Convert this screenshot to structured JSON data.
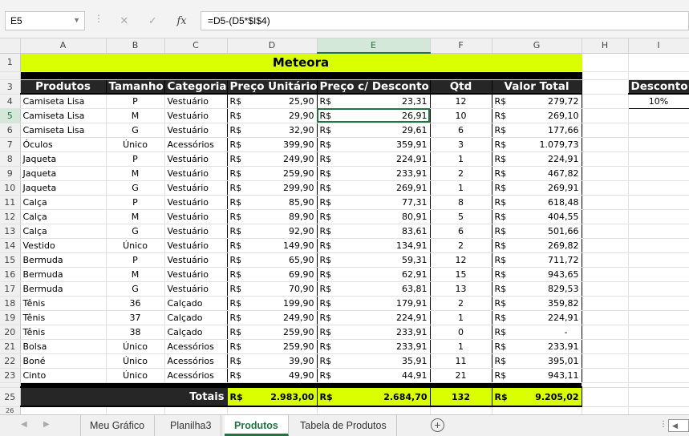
{
  "formula_bar": {
    "name_box": "E5",
    "formula": "=D5-(D5*$I$4)",
    "cancel_icon": "✕",
    "enter_icon": "✓",
    "fx_label": "fx"
  },
  "columns": [
    "A",
    "B",
    "C",
    "D",
    "E",
    "F",
    "G",
    "H",
    "I"
  ],
  "row_numbers": {
    "r1": "1",
    "r3": "3",
    "r25": "25",
    "r26": "26"
  },
  "title": "Meteora",
  "headers": {
    "produtos": "Produtos",
    "tamanho": "Tamanho",
    "categoria": "Categoria",
    "preco_unit": "Preço Unitário",
    "preco_desc": "Preço c/ Desconto",
    "qtd": "Qtd",
    "valor_total": "Valor Total"
  },
  "currency": "R$",
  "rows": [
    {
      "n": "4",
      "produto": "Camiseta Lisa",
      "tamanho": "P",
      "categoria": "Vestuário",
      "preco": "25,90",
      "desc": "23,31",
      "qtd": "12",
      "total": "279,72"
    },
    {
      "n": "5",
      "produto": "Camiseta Lisa",
      "tamanho": "M",
      "categoria": "Vestuário",
      "preco": "29,90",
      "desc": "26,91",
      "qtd": "10",
      "total": "269,10"
    },
    {
      "n": "6",
      "produto": "Camiseta Lisa",
      "tamanho": "G",
      "categoria": "Vestuário",
      "preco": "32,90",
      "desc": "29,61",
      "qtd": "6",
      "total": "177,66"
    },
    {
      "n": "7",
      "produto": "Óculos",
      "tamanho": "Único",
      "categoria": "Acessórios",
      "preco": "399,90",
      "desc": "359,91",
      "qtd": "3",
      "total": "1.079,73"
    },
    {
      "n": "8",
      "produto": "Jaqueta",
      "tamanho": "P",
      "categoria": "Vestuário",
      "preco": "249,90",
      "desc": "224,91",
      "qtd": "1",
      "total": "224,91"
    },
    {
      "n": "9",
      "produto": "Jaqueta",
      "tamanho": "M",
      "categoria": "Vestuário",
      "preco": "259,90",
      "desc": "233,91",
      "qtd": "2",
      "total": "467,82"
    },
    {
      "n": "10",
      "produto": "Jaqueta",
      "tamanho": "G",
      "categoria": "Vestuário",
      "preco": "299,90",
      "desc": "269,91",
      "qtd": "1",
      "total": "269,91"
    },
    {
      "n": "11",
      "produto": "Calça",
      "tamanho": "P",
      "categoria": "Vestuário",
      "preco": "85,90",
      "desc": "77,31",
      "qtd": "8",
      "total": "618,48"
    },
    {
      "n": "12",
      "produto": "Calça",
      "tamanho": "M",
      "categoria": "Vestuário",
      "preco": "89,90",
      "desc": "80,91",
      "qtd": "5",
      "total": "404,55"
    },
    {
      "n": "13",
      "produto": "Calça",
      "tamanho": "G",
      "categoria": "Vestuário",
      "preco": "92,90",
      "desc": "83,61",
      "qtd": "6",
      "total": "501,66"
    },
    {
      "n": "14",
      "produto": "Vestido",
      "tamanho": "Único",
      "categoria": "Vestuário",
      "preco": "149,90",
      "desc": "134,91",
      "qtd": "2",
      "total": "269,82"
    },
    {
      "n": "15",
      "produto": "Bermuda",
      "tamanho": "P",
      "categoria": "Vestuário",
      "preco": "65,90",
      "desc": "59,31",
      "qtd": "12",
      "total": "711,72"
    },
    {
      "n": "16",
      "produto": "Bermuda",
      "tamanho": "M",
      "categoria": "Vestuário",
      "preco": "69,90",
      "desc": "62,91",
      "qtd": "15",
      "total": "943,65"
    },
    {
      "n": "17",
      "produto": "Bermuda",
      "tamanho": "G",
      "categoria": "Vestuário",
      "preco": "70,90",
      "desc": "63,81",
      "qtd": "13",
      "total": "829,53"
    },
    {
      "n": "18",
      "produto": "Tênis",
      "tamanho": "36",
      "categoria": "Calçado",
      "preco": "199,90",
      "desc": "179,91",
      "qtd": "2",
      "total": "359,82"
    },
    {
      "n": "19",
      "produto": "Tênis",
      "tamanho": "37",
      "categoria": "Calçado",
      "preco": "249,90",
      "desc": "224,91",
      "qtd": "1",
      "total": "224,91"
    },
    {
      "n": "20",
      "produto": "Tênis",
      "tamanho": "38",
      "categoria": "Calçado",
      "preco": "259,90",
      "desc": "233,91",
      "qtd": "0",
      "total": "-"
    },
    {
      "n": "21",
      "produto": "Bolsa",
      "tamanho": "Único",
      "categoria": "Acessórios",
      "preco": "259,90",
      "desc": "233,91",
      "qtd": "1",
      "total": "233,91"
    },
    {
      "n": "22",
      "produto": "Boné",
      "tamanho": "Único",
      "categoria": "Acessórios",
      "preco": "39,90",
      "desc": "35,91",
      "qtd": "11",
      "total": "395,01"
    },
    {
      "n": "23",
      "produto": "Cinto",
      "tamanho": "Único",
      "categoria": "Acessórios",
      "preco": "49,90",
      "desc": "44,91",
      "qtd": "21",
      "total": "943,11"
    }
  ],
  "totals": {
    "label": "Totais",
    "preco": "2.983,00",
    "desc": "2.684,70",
    "qtd": "132",
    "total": "9.205,02"
  },
  "desconto": {
    "label": "Desconto",
    "value": "10%"
  },
  "tabs": [
    "Meu Gráfico",
    "Planilha3",
    "Produtos",
    "Tabela de Produtos"
  ],
  "active_tab": "Produtos",
  "colors": {
    "accent": "#217346",
    "title_bg": "#d9ff00",
    "header_bg": "#262626"
  }
}
